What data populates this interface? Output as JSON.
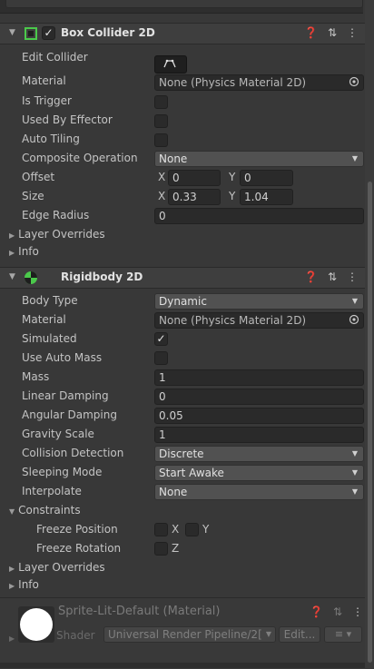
{
  "box_collider": {
    "title": "Box Collider 2D",
    "enabled": "✓",
    "edit_collider_label": "Edit Collider",
    "material_label": "Material",
    "material_value": "None (Physics Material 2D)",
    "is_trigger_label": "Is Trigger",
    "used_by_effector_label": "Used By Effector",
    "auto_tiling_label": "Auto Tiling",
    "composite_operation_label": "Composite Operation",
    "composite_operation_value": "None",
    "offset_label": "Offset",
    "offset_x": "0",
    "offset_y": "0",
    "size_label": "Size",
    "size_x": "0.33",
    "size_y": "1.04",
    "edge_radius_label": "Edge Radius",
    "edge_radius_value": "0",
    "layer_overrides_label": "Layer Overrides",
    "info_label": "Info"
  },
  "rigidbody": {
    "title": "Rigidbody 2D",
    "body_type_label": "Body Type",
    "body_type_value": "Dynamic",
    "material_label": "Material",
    "material_value": "None (Physics Material 2D)",
    "simulated_label": "Simulated",
    "simulated_check": "✓",
    "use_auto_mass_label": "Use Auto Mass",
    "mass_label": "Mass",
    "mass_value": "1",
    "linear_damping_label": "Linear Damping",
    "linear_damping_value": "0",
    "angular_damping_label": "Angular Damping",
    "angular_damping_value": "0.05",
    "gravity_scale_label": "Gravity Scale",
    "gravity_scale_value": "1",
    "collision_detection_label": "Collision Detection",
    "collision_detection_value": "Discrete",
    "sleeping_mode_label": "Sleeping Mode",
    "sleeping_mode_value": "Start Awake",
    "interpolate_label": "Interpolate",
    "interpolate_value": "None",
    "constraints_label": "Constraints",
    "freeze_position_label": "Freeze Position",
    "freeze_rotation_label": "Freeze Rotation",
    "axis_x": "X",
    "axis_y": "Y",
    "axis_z": "Z",
    "layer_overrides_label": "Layer Overrides",
    "info_label": "Info"
  },
  "axes": {
    "x": "X",
    "y": "Y"
  },
  "material_asset": {
    "title": "Sprite-Lit-Default (Material)",
    "shader_label": "Shader",
    "shader_value": "Universal Render Pipeline/2[",
    "edit_label": "Edit...",
    "list_label": "≡ ▾"
  },
  "header_icons": {
    "help": "❓",
    "settings": "⇅",
    "menu": "⋮"
  },
  "colors": {
    "accent_green": "#4bc94b",
    "panel_bg": "#383838",
    "header_bg": "#3e3e3e",
    "field_bg": "#2a2a2a",
    "dropdown_bg": "#515151"
  }
}
